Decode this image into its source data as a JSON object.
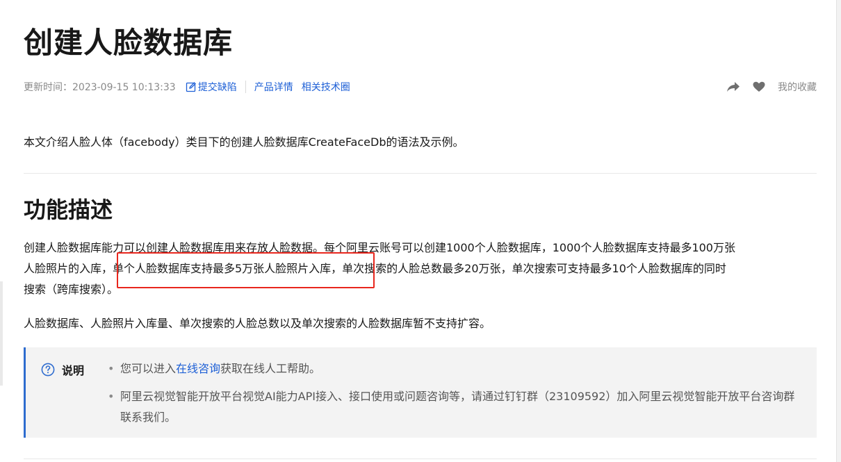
{
  "article": {
    "title": "创建人脸数据库",
    "meta": {
      "updated_label": "更新时间：2023-09-15 10:13:33",
      "report_link": "提交缺陷",
      "links": [
        "产品详情",
        "相关技术圈"
      ],
      "favorites_label": "我的收藏",
      "icons": [
        "edit-icon",
        "share-icon",
        "heart-icon"
      ]
    },
    "intro": "本文介绍人脸人体（facebody）类目下的创建人脸数据库CreateFaceDb的语法及示例。",
    "section_title": "功能描述",
    "para1": {
      "line1": "创建人脸数据库能力可以创建人脸数据库用来存放人脸数据。每个阿里云账号可以创建1000个人脸数据库，1000个人脸数据库支持最多100万张",
      "line2": "人脸照片的入库，单个人脸数据库支持最多5万张人脸照片入库，单次搜索的人脸总数最多20万张，单次搜索可支持最多10个人脸数据库的同时",
      "line3": "搜索（跨库搜索）。"
    },
    "para2": "人脸数据库、人脸照片入库量、单次搜索的人脸总数以及单次搜索的人脸数据库暂不支持扩容。",
    "note": {
      "label": "说明",
      "item1_prefix": "您可以进入",
      "item1_link": "在线咨询",
      "item1_suffix": "获取在线人工帮助。",
      "item2": "阿里云视觉智能开放平台视觉AI能力API接入、接口使用或问题咨询等，请通过钉钉群（23109592）加入阿里云视觉智能开放平台咨询群联系我们。"
    }
  },
  "colors": {
    "link": "#1d5fd6",
    "highlight_box": "#e8261d",
    "note_accent": "#2e6ccf",
    "note_background": "#f3f3f3"
  }
}
